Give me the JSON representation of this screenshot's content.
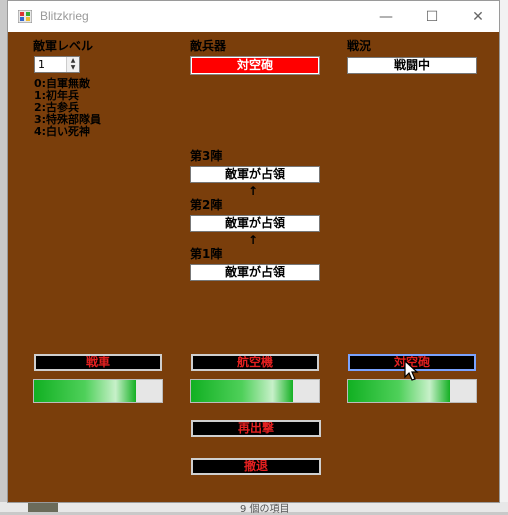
{
  "window": {
    "title": "Blitzkrieg"
  },
  "titlebar_buttons": {
    "minimize": "—",
    "maximize": "☐",
    "close": "✕"
  },
  "enemy_level": {
    "label": "敵軍レベル",
    "value": "1",
    "legend": [
      "0:自軍無敵",
      "1:初年兵",
      "2:古参兵",
      "3:特殊部隊員",
      "4:白い死神"
    ]
  },
  "enemy_weapon": {
    "label": "敵兵器",
    "value": "対空砲"
  },
  "battle_status": {
    "label": "戦況",
    "value": "戦闘中"
  },
  "fronts": [
    {
      "label": "第3陣",
      "value": "敵軍が占領"
    },
    {
      "label": "第2陣",
      "value": "敵軍が占領"
    },
    {
      "label": "第1陣",
      "value": "敵軍が占領"
    }
  ],
  "arrow_glyph": "↑",
  "weapons": [
    {
      "label": "戦車",
      "progress": 0.8
    },
    {
      "label": "航空機",
      "progress": 0.8
    },
    {
      "label": "対空砲",
      "progress": 0.8
    }
  ],
  "actions": {
    "resortie": "再出撃",
    "retreat": "撤退"
  },
  "desktop": {
    "status_text": "9 個の項目"
  }
}
